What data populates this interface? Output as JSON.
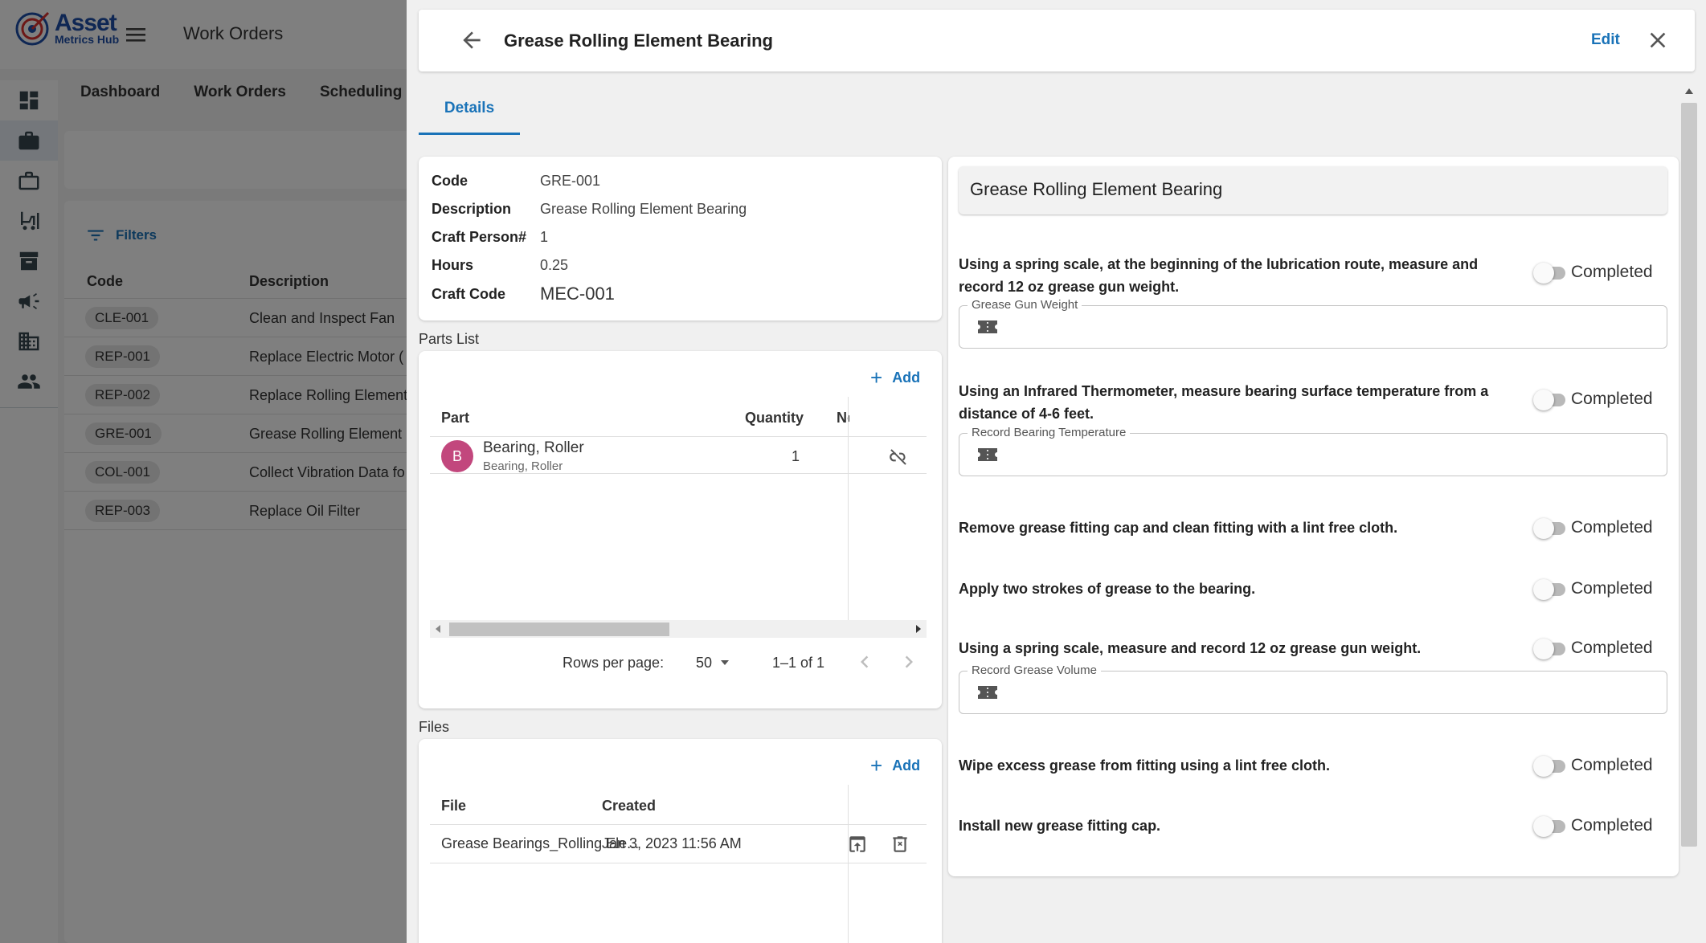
{
  "app": {
    "logo_line1": "Asset",
    "logo_line2": "Metrics Hub",
    "title": "Work Orders"
  },
  "nav_tabs": [
    "Dashboard",
    "Work Orders",
    "Scheduling"
  ],
  "rail_icons": [
    "dashboard-icon",
    "briefcase-icon",
    "briefcase-outline-icon",
    "forklift-icon",
    "archive-icon",
    "campaign-icon",
    "building-icon",
    "people-icon"
  ],
  "list": {
    "filters_label": "Filters",
    "columns": [
      "Code",
      "Description"
    ],
    "rows": [
      {
        "code": "CLE-001",
        "description": "Clean and Inspect Fan"
      },
      {
        "code": "REP-001",
        "description": "Replace Electric Motor ("
      },
      {
        "code": "REP-002",
        "description": "Replace Rolling Element"
      },
      {
        "code": "GRE-001",
        "description": "Grease Rolling Element"
      },
      {
        "code": "COL-001",
        "description": "Collect Vibration Data fo"
      },
      {
        "code": "REP-003",
        "description": "Replace Oil Filter"
      }
    ]
  },
  "drawer": {
    "title": "Grease Rolling Element Bearing",
    "edit_label": "Edit",
    "tab": "Details",
    "info": {
      "code_label": "Code",
      "code": "GRE-001",
      "description_label": "Description",
      "description": "Grease Rolling Element Bearing",
      "craft_person_label": "Craft Person#",
      "craft_person": "1",
      "hours_label": "Hours",
      "hours": "0.25",
      "craft_code_label": "Craft Code",
      "craft_code": "MEC-001"
    },
    "parts": {
      "section_label": "Parts List",
      "add_label": "Add",
      "columns": [
        "Part",
        "Quantity",
        "No"
      ],
      "rows": [
        {
          "avatar": "B",
          "name": "Bearing, Roller",
          "sub": "Bearing, Roller",
          "quantity": "1"
        }
      ],
      "rows_per_page_label": "Rows per page:",
      "rows_per_page": "50",
      "range": "1–1 of 1"
    },
    "files": {
      "section_label": "Files",
      "add_label": "Add",
      "columns": [
        "File",
        "Created"
      ],
      "rows": [
        {
          "file": "Grease Bearings_Rolling Ele...",
          "created": "Jan 3, 2023 11:56 AM"
        }
      ]
    },
    "steps": {
      "header": "Grease Rolling Element Bearing",
      "toggle_label": "Completed",
      "items": [
        {
          "text": "Using a spring scale, at the beginning of the lubrication route, measure and record 12 oz grease gun weight.",
          "field": "Grease Gun Weight",
          "completed": false
        },
        {
          "text": "Using an Infrared Thermometer, measure bearing surface temperature from a distance of 4-6 feet.",
          "field": "Record Bearing Temperature",
          "completed": false
        },
        {
          "text": "Remove grease fitting cap and clean fitting with a lint free cloth.",
          "completed": false
        },
        {
          "text": "Apply two strokes of grease to the bearing.",
          "completed": false
        },
        {
          "text": "Using a spring scale, measure and record 12 oz grease gun weight.",
          "field": "Record Grease Volume",
          "completed": false
        },
        {
          "text": "Wipe excess grease from fitting using a lint free cloth.",
          "completed": false
        },
        {
          "text": "Install new grease fitting cap.",
          "completed": false
        }
      ]
    }
  },
  "colors": {
    "accent": "#1a73b8",
    "avatar": "#c2477d",
    "overlay": "rgba(0,0,0,0.5)"
  }
}
